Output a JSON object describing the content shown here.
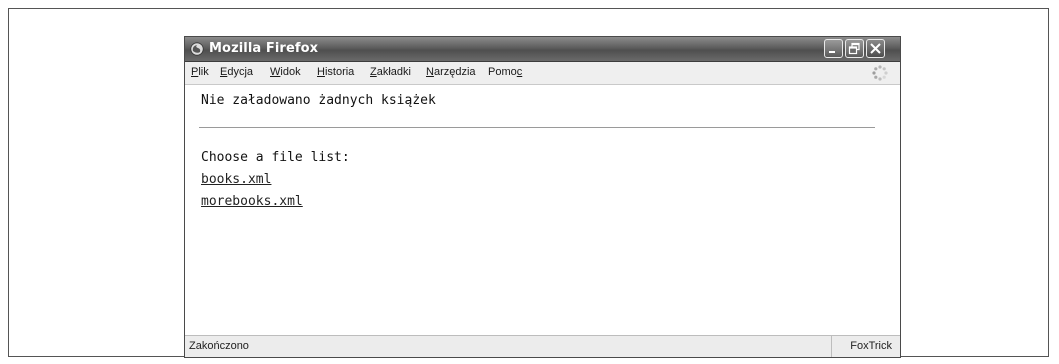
{
  "window": {
    "title": "Mozilla Firefox"
  },
  "titlebar_buttons": {
    "minimize_icon": "minimize-icon",
    "maximize_icon": "restore-icon",
    "close_icon": "close-icon"
  },
  "menubar": {
    "items": [
      {
        "label": "Plik",
        "access_key": "P"
      },
      {
        "label": "Edycja",
        "access_key": "E"
      },
      {
        "label": "Widok",
        "access_key": "W"
      },
      {
        "label": "Historia",
        "access_key": "H"
      },
      {
        "label": "Zakładki",
        "access_key": "Z"
      },
      {
        "label": "Narzędzia",
        "access_key": "N"
      },
      {
        "label": "Pomoc",
        "access_key": "c"
      }
    ]
  },
  "content": {
    "status_message": "Nie załadowano żadnych książek",
    "choose_label": "Choose a file list:",
    "links": [
      "books.xml",
      "morebooks.xml"
    ]
  },
  "statusbar": {
    "left": "Zakończono",
    "right": "FoxTrick"
  }
}
